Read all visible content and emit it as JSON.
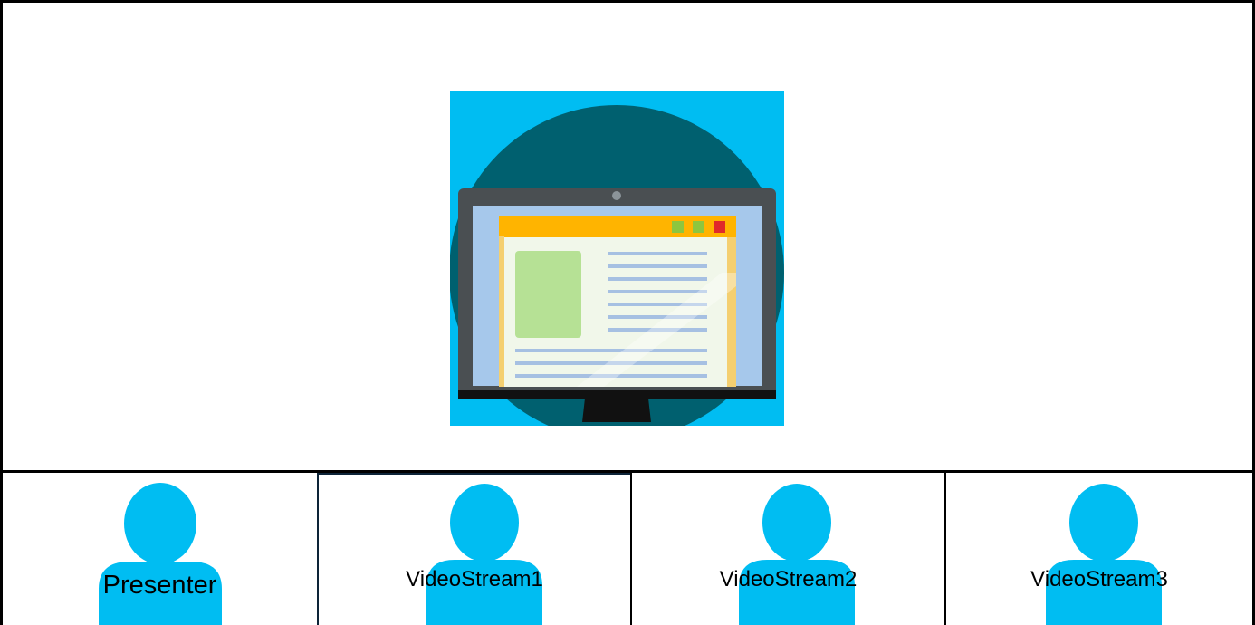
{
  "stage": {
    "shared_screen_icon": "monitor-browser-window-icon",
    "colors": {
      "background": "#00bdf2",
      "circle": "#00606f",
      "monitor_bezel": "#4a4f52",
      "screen": "#a6c8eb",
      "window_titlebar": "#ffb400",
      "window_body": "#f1f7ea",
      "image_block": "#b6e195",
      "text_lines": "#a6c0e2"
    }
  },
  "streams": [
    {
      "label": "Presenter",
      "avatar_icon": "person-avatar-icon",
      "color": "#00bdf2"
    },
    {
      "label": "VideoStream1",
      "avatar_icon": "person-avatar-icon",
      "color": "#00bdf2"
    },
    {
      "label": "VideoStream2",
      "avatar_icon": "person-avatar-icon",
      "color": "#00bdf2"
    },
    {
      "label": "VideoStream3",
      "avatar_icon": "person-avatar-icon",
      "color": "#00bdf2"
    }
  ]
}
